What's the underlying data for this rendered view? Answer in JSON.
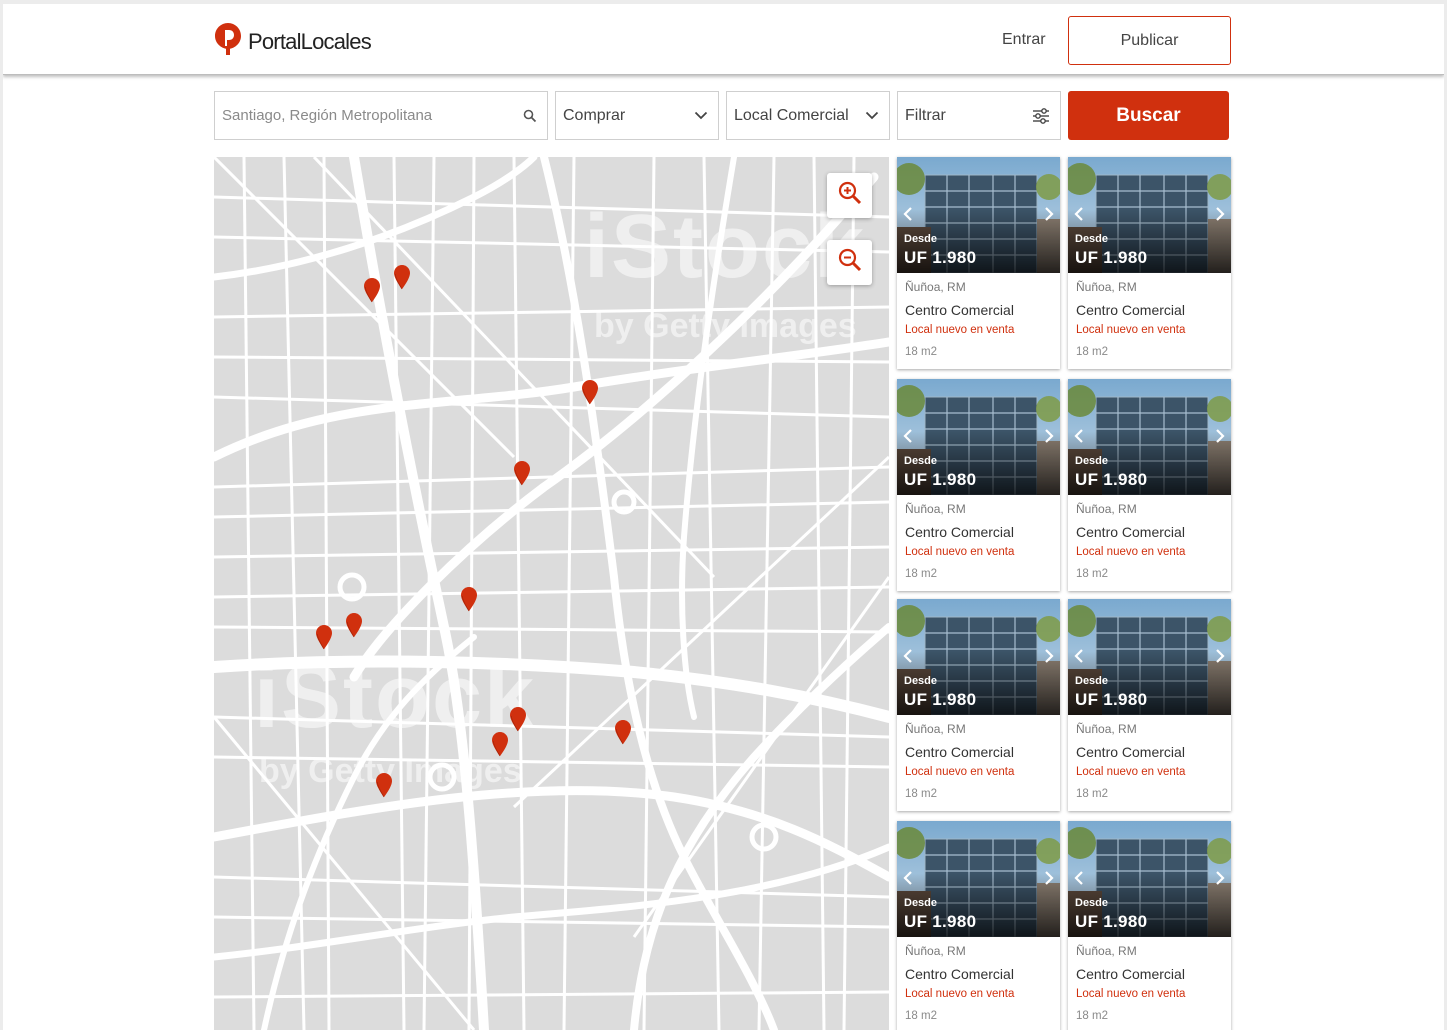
{
  "header": {
    "brand": "PortalLocales",
    "login_label": "Entrar",
    "publish_label": "Publicar"
  },
  "search": {
    "location_placeholder": "Santiago, Región Metropolitana",
    "operation_value": "Comprar",
    "property_type_value": "Local Comercial",
    "filter_label": "Filtrar",
    "submit_label": "Buscar"
  },
  "map": {
    "watermark": "iStock by Getty Images",
    "marker_count": 13
  },
  "listings": [
    {
      "desde": "Desde",
      "price": "UF 1.980",
      "location": "Ñuñoa, RM",
      "title": "Centro Comercial",
      "subtitle": "Local nuevo en venta",
      "size": "18 m2"
    },
    {
      "desde": "Desde",
      "price": "UF 1.980",
      "location": "Ñuñoa, RM",
      "title": "Centro Comercial",
      "subtitle": "Local nuevo en venta",
      "size": "18 m2"
    },
    {
      "desde": "Desde",
      "price": "UF 1.980",
      "location": "Ñuñoa, RM",
      "title": "Centro Comercial",
      "subtitle": "Local nuevo en venta",
      "size": "18 m2"
    },
    {
      "desde": "Desde",
      "price": "UF 1.980",
      "location": "Ñuñoa, RM",
      "title": "Centro Comercial",
      "subtitle": "Local nuevo en venta",
      "size": "18 m2"
    },
    {
      "desde": "Desde",
      "price": "UF 1.980",
      "location": "Ñuñoa, RM",
      "title": "Centro Comercial",
      "subtitle": "Local nuevo en venta",
      "size": "18 m2"
    },
    {
      "desde": "Desde",
      "price": "UF 1.980",
      "location": "Ñuñoa, RM",
      "title": "Centro Comercial",
      "subtitle": "Local nuevo en venta",
      "size": "18 m2"
    },
    {
      "desde": "Desde",
      "price": "UF 1.980",
      "location": "Ñuñoa, RM",
      "title": "Centro Comercial",
      "subtitle": "Local nuevo en venta",
      "size": "18 m2"
    },
    {
      "desde": "Desde",
      "price": "UF 1.980",
      "location": "Ñuñoa, RM",
      "title": "Centro Comercial",
      "subtitle": "Local nuevo en venta",
      "size": "18 m2"
    }
  ],
  "colors": {
    "accent": "#d0300e",
    "map_background": "#dcdcdc",
    "map_streets": "#ffffff"
  },
  "icons": [
    "logo-pin-icon",
    "search-icon",
    "chevron-down-icon",
    "sliders-icon",
    "zoom-in-icon",
    "zoom-out-icon",
    "map-marker-icon",
    "chevron-left-icon",
    "chevron-right-icon"
  ]
}
